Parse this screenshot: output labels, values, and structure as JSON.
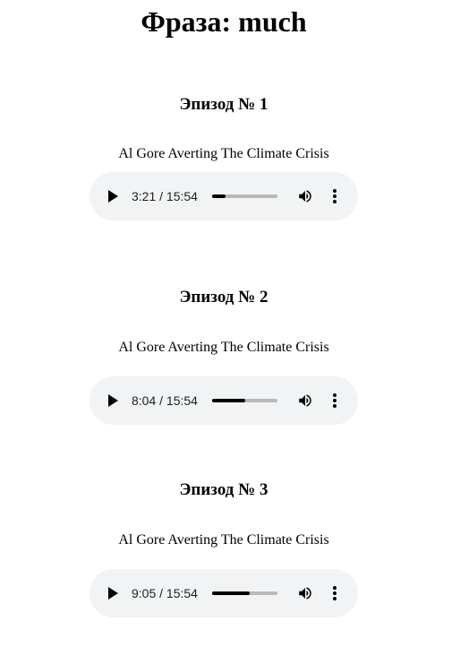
{
  "page": {
    "title": "Фраза: much"
  },
  "episodes": [
    {
      "heading": "Эпизод № 1",
      "description": "Al Gore Averting The Climate Crisis",
      "player": {
        "time": "3:21 / 15:54",
        "progress": 0.21,
        "icons": {
          "play": "play-icon",
          "volume": "volume-icon",
          "menu": "more-vert-icon"
        }
      }
    },
    {
      "heading": "Эпизод № 2",
      "description": "Al Gore Averting The Climate Crisis",
      "player": {
        "time": "8:04 / 15:54",
        "progress": 0.507,
        "icons": {
          "play": "play-icon",
          "volume": "volume-icon",
          "menu": "more-vert-icon"
        }
      }
    },
    {
      "heading": "Эпизод № 3",
      "description": "Al Gore Averting The Climate Crisis",
      "player": {
        "time": "9:05 / 15:54",
        "progress": 0.571,
        "icons": {
          "play": "play-icon",
          "volume": "volume-icon",
          "menu": "more-vert-icon"
        }
      }
    }
  ]
}
